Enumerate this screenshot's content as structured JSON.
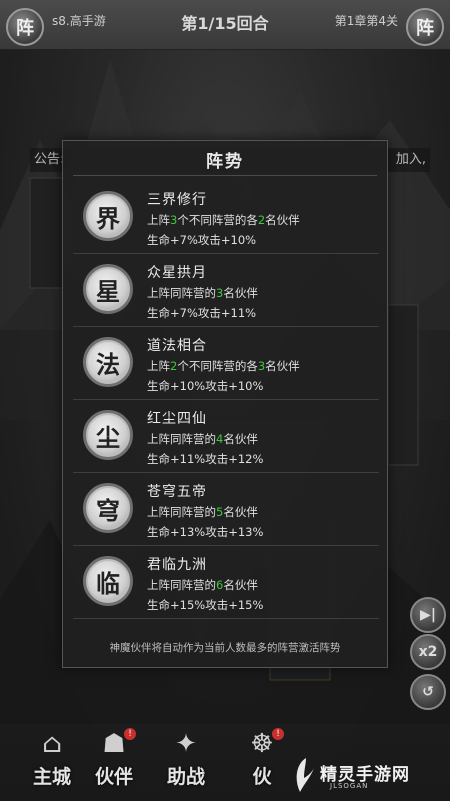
{
  "header": {
    "left_button": "阵",
    "right_button": "阵",
    "server": "s8.高手游",
    "round": "第1/15回合",
    "chapter": "第1章第4关"
  },
  "notice": {
    "left": "公告:",
    "right": "加入,"
  },
  "modal": {
    "title": "阵势",
    "rows": [
      {
        "glyph": "界",
        "name": "三界修行",
        "cond": [
          "上阵",
          "3",
          "个不同阵营的各",
          "2",
          "名伙伴"
        ],
        "bonus": "生命+7%攻击+10%"
      },
      {
        "glyph": "星",
        "name": "众星拱月",
        "cond": [
          "上阵同阵营的",
          "3",
          "名伙伴",
          "",
          ""
        ],
        "bonus": "生命+7%攻击+11%"
      },
      {
        "glyph": "法",
        "name": "道法相合",
        "cond": [
          "上阵",
          "2",
          "个不同阵营的各",
          "3",
          "名伙伴"
        ],
        "bonus": "生命+10%攻击+10%"
      },
      {
        "glyph": "尘",
        "name": "红尘四仙",
        "cond": [
          "上阵同阵营的",
          "4",
          "名伙伴",
          "",
          ""
        ],
        "bonus": "生命+11%攻击+12%"
      },
      {
        "glyph": "穹",
        "name": "苍穹五帝",
        "cond": [
          "上阵同阵营的",
          "5",
          "名伙伴",
          "",
          ""
        ],
        "bonus": "生命+13%攻击+13%"
      },
      {
        "glyph": "临",
        "name": "君临九洲",
        "cond": [
          "上阵同阵营的",
          "6",
          "名伙伴",
          "",
          ""
        ],
        "bonus": "生命+15%攻击+15%"
      }
    ],
    "footer": "神魔伙伴将自动作为当前人数最多的阵营激活阵势"
  },
  "side": {
    "skip_icon": "▶|",
    "speed": "x2",
    "back_icon": "↺"
  },
  "nav": [
    {
      "label": "主城",
      "icon": "castle-icon",
      "glyph": "⌂",
      "dot": ""
    },
    {
      "label": "伙伴",
      "icon": "partner-icon",
      "glyph": "☗",
      "dot": "!"
    },
    {
      "label": "助战",
      "icon": "assist-icon",
      "glyph": "✦",
      "dot": ""
    },
    {
      "label": "伙",
      "icon": "team-icon",
      "glyph": "☸",
      "dot": "!"
    }
  ],
  "watermark": {
    "text": "精灵手游网",
    "sub": "JLSOGAN"
  },
  "colors": {
    "highlight": "#3ec83e"
  }
}
